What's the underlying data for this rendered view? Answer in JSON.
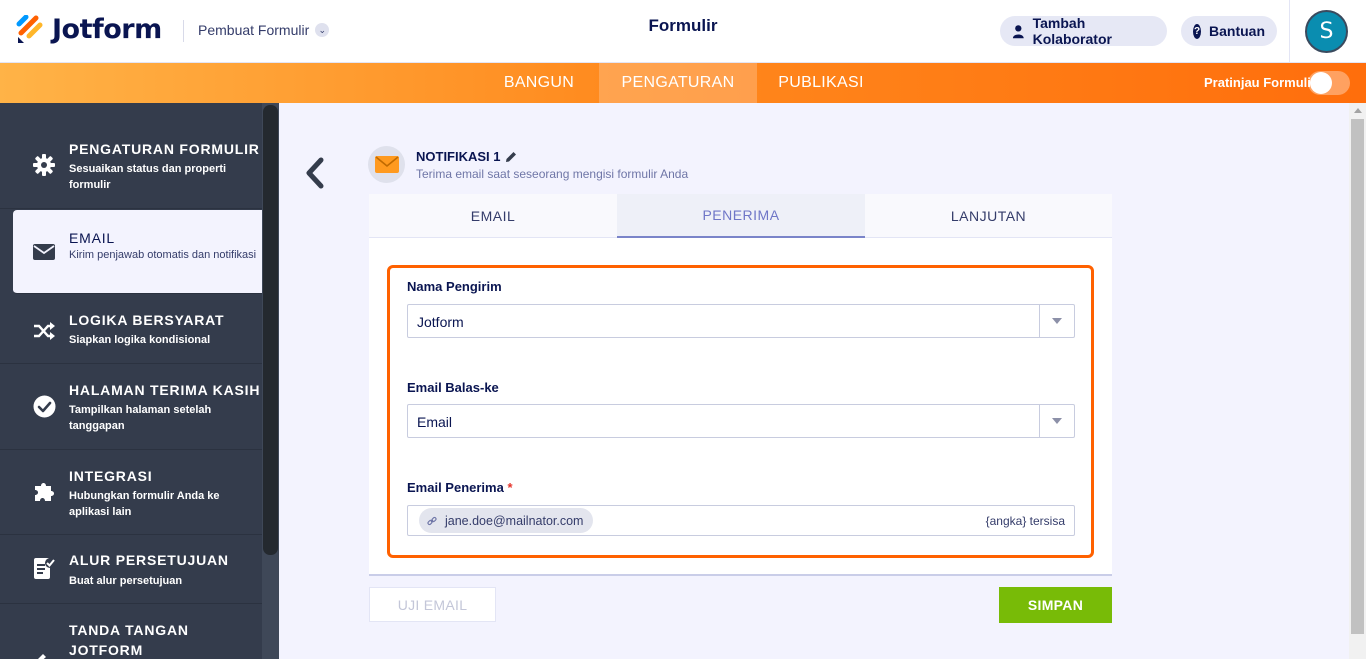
{
  "header": {
    "brand": "Jotform",
    "builder_menu": "Pembuat Formulir",
    "title": "Formulir",
    "collaborator_button": "Tambah Kolaborator",
    "help_button": "Bantuan",
    "avatar_initial": "S"
  },
  "nav": {
    "tabs": [
      "BANGUN",
      "PENGATURAN",
      "PUBLIKASI"
    ],
    "active_tab": "PENGATURAN",
    "preview_label": "Pratinjau Formulir",
    "preview_toggle_on": false
  },
  "sidebar": {
    "items": [
      {
        "title": "PENGATURAN FORMULIR",
        "desc": "Sesuaikan status dan properti formulir",
        "icon": "gear-icon"
      },
      {
        "title": "EMAIL",
        "desc": "Kirim penjawab otomatis dan notifikasi",
        "icon": "envelope-icon",
        "active": true
      },
      {
        "title": "LOGIKA BERSYARAT",
        "desc": "Siapkan logika kondisional",
        "icon": "shuffle-icon"
      },
      {
        "title": "HALAMAN TERIMA KASIH",
        "desc": "Tampilkan halaman setelah tanggapan",
        "icon": "check-circle-icon"
      },
      {
        "title": "INTEGRASI",
        "desc": "Hubungkan formulir Anda ke aplikasi lain",
        "icon": "puzzle-icon"
      },
      {
        "title": "ALUR PERSETUJUAN",
        "desc": "Buat alur persetujuan",
        "icon": "approval-icon"
      },
      {
        "title": "TANDA TANGAN JOTFORM",
        "desc": "",
        "icon": "signature-icon"
      }
    ]
  },
  "notification": {
    "title": "NOTIFIKASI 1",
    "subtitle": "Terima email saat seseorang mengisi formulir Anda"
  },
  "tabs": {
    "items": [
      "EMAIL",
      "PENERIMA",
      "LANJUTAN"
    ],
    "active": "PENERIMA"
  },
  "form": {
    "sender_name_label": "Nama Pengirim",
    "sender_name_value": "Jotform",
    "reply_to_label": "Email Balas-ke",
    "reply_to_value": "Email",
    "recipient_label": "Email Penerima",
    "recipient_required_mark": "*",
    "recipient_chip": "jane.doe@mailnator.com",
    "remaining_text": "{angka} tersisa"
  },
  "actions": {
    "test_email": "UJI EMAIL",
    "save": "SIMPAN"
  },
  "colors": {
    "brand_orange": "#ff6100",
    "sidebar_bg": "#343c4c",
    "save_green": "#78bb07",
    "navy": "#0a1551"
  }
}
